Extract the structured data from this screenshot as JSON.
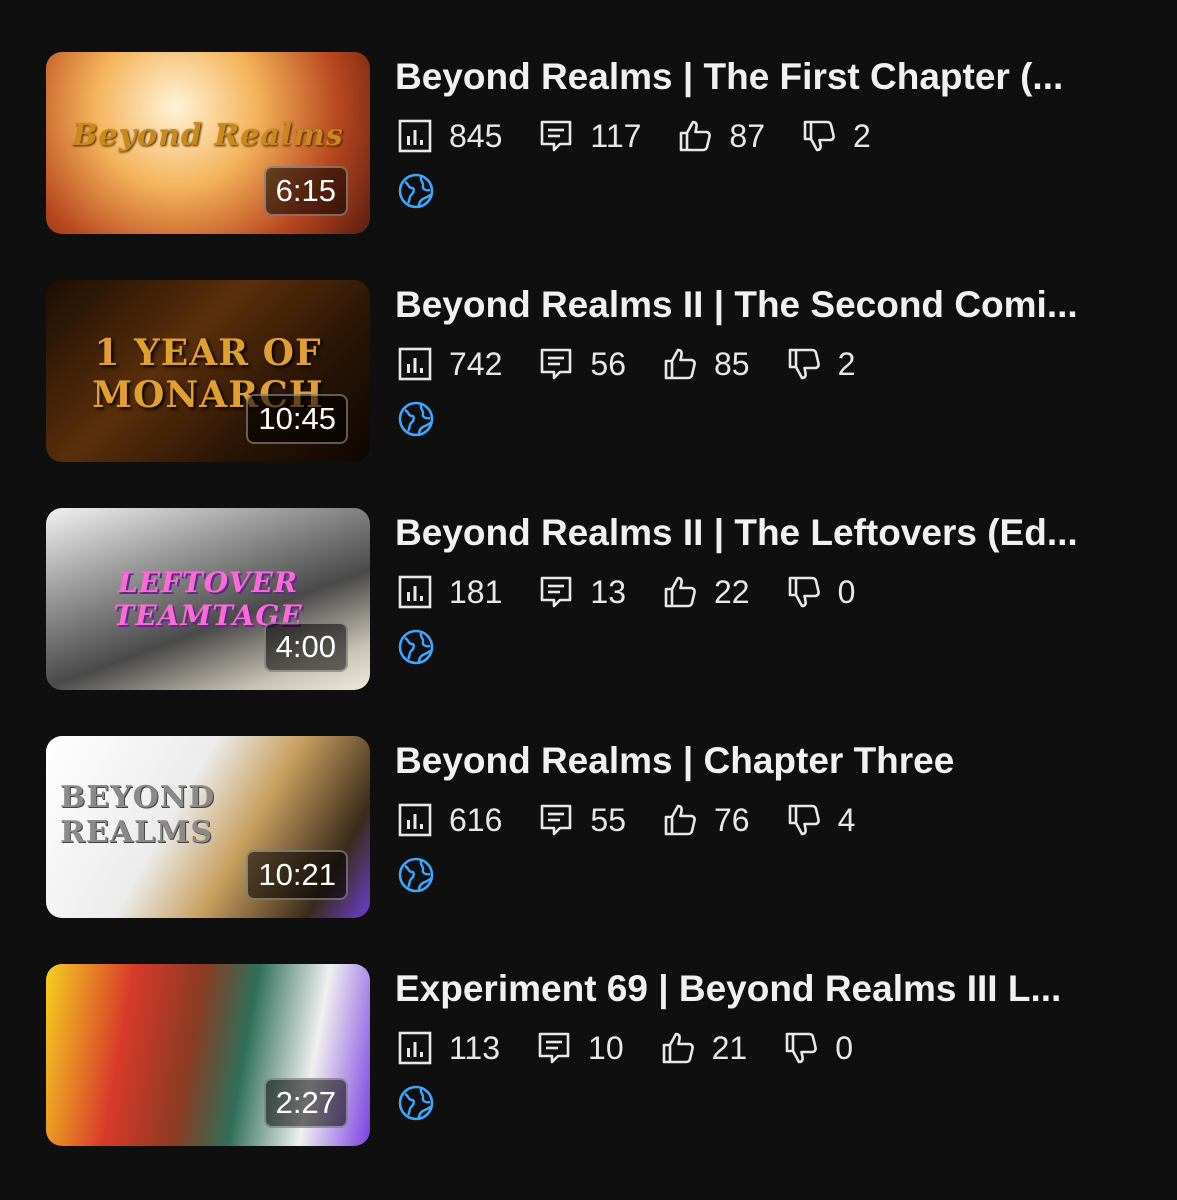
{
  "videos": [
    {
      "title": "Beyond Realms | The First Chapter (...",
      "duration": "6:15",
      "views": "845",
      "comments": "117",
      "likes": "87",
      "dislikes": "2",
      "visibility_icon": "globe-icon"
    },
    {
      "title": "Beyond Realms II | The Second Comi...",
      "duration": "10:45",
      "views": "742",
      "comments": "56",
      "likes": "85",
      "dislikes": "2",
      "visibility_icon": "globe-icon"
    },
    {
      "title": "Beyond Realms II | The Leftovers (Ed...",
      "duration": "4:00",
      "views": "181",
      "comments": "13",
      "likes": "22",
      "dislikes": "0",
      "visibility_icon": "globe-icon"
    },
    {
      "title": "Beyond Realms | Chapter Three",
      "duration": "10:21",
      "views": "616",
      "comments": "55",
      "likes": "76",
      "dislikes": "4",
      "visibility_icon": "globe-icon"
    },
    {
      "title": "Experiment 69 | Beyond Realms III L...",
      "duration": "2:27",
      "views": "113",
      "comments": "10",
      "likes": "21",
      "dislikes": "0",
      "visibility_icon": "globe-icon"
    }
  ],
  "thumbnails": [
    {
      "art_text": "Beyond Realms"
    },
    {
      "art_text": "1 YEAR OF MONARCH"
    },
    {
      "art_text": "LEFTOVER TEAMTAGE"
    },
    {
      "art_text": "BEYOND REALMS"
    },
    {
      "art_text": ""
    }
  ],
  "colors": {
    "background": "#0f0f0f",
    "text": "#f1f1f1",
    "icon": "#e8e8e8",
    "globe": "#3ea6ff"
  }
}
